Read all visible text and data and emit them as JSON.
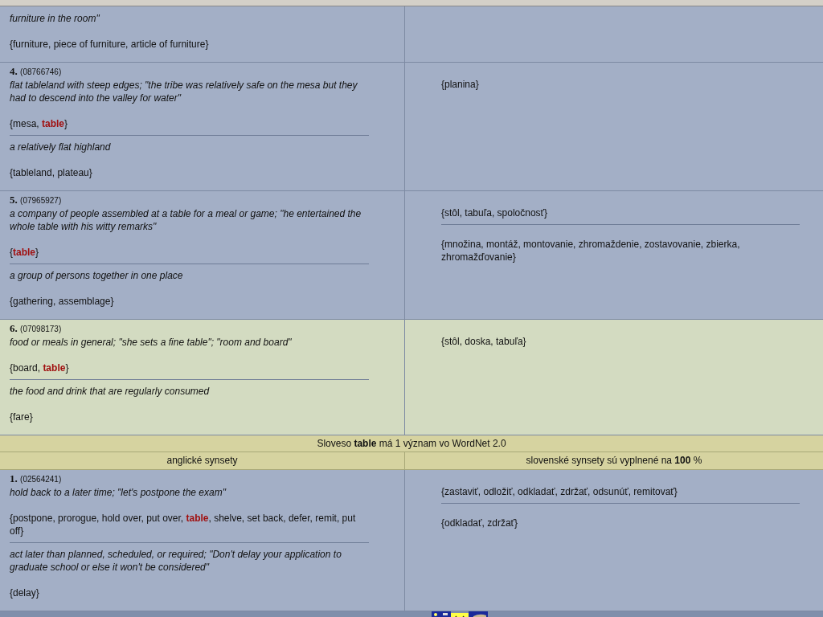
{
  "noun_rows": [
    {
      "highlighted": false,
      "english": [
        {
          "gloss": "furniture in the room\"",
          "synset": "{furniture, piece of furniture, article of furniture}"
        }
      ],
      "slovak": []
    },
    {
      "number": "4.",
      "id": "(08766746)",
      "highlighted": false,
      "english": [
        {
          "gloss": "flat tableland with steep edges; \"the tribe was relatively safe on the mesa but they had to descend into the valley for water\"",
          "synset": "{mesa, **table**}"
        },
        {
          "gloss": "a relatively flat highland",
          "synset": "{tableland, plateau}"
        }
      ],
      "slovak": [
        "{planina}"
      ]
    },
    {
      "number": "5.",
      "id": "(07965927)",
      "highlighted": false,
      "english": [
        {
          "gloss": "a company of people assembled at a table for a meal or game; \"he entertained the whole table with his witty remarks\"",
          "synset": "{**table**}"
        },
        {
          "gloss": "a group of persons together in one place",
          "synset": "{gathering, assemblage}"
        }
      ],
      "slovak": [
        "{stôl, tabuľa, spoločnosť}",
        "{množina, montáž, montovanie, zhromaždenie, zostavovanie, zbierka, zhromažďovanie}"
      ]
    },
    {
      "number": "6.",
      "id": "(07098173)",
      "highlighted": true,
      "english": [
        {
          "gloss": "food or meals in general; \"she sets a fine table\"; \"room and board\"",
          "synset": "{board, **table**}"
        },
        {
          "gloss": "the food and drink that are regularly consumed",
          "synset": "{fare}"
        }
      ],
      "slovak": [
        "{stôl, doska, tabuľa}"
      ]
    }
  ],
  "verb_section": {
    "heading": "Sloveso **table** má 1 význam vo WordNet 2.0",
    "columns": [
      "anglické synsety",
      "slovenské synsety sú vyplnené na **100** %"
    ],
    "rows": [
      {
        "number": "1.",
        "id": "(02564241)",
        "highlighted": false,
        "english": [
          {
            "gloss": "hold back to a later time; \"let's postpone the exam\"",
            "synset": "{postpone, prorogue, hold over, put over, **table**, shelve, set back, defer, remit, put off}"
          },
          {
            "gloss": "act later than planned, scheduled, or required; \"Don't delay your application to graduate school or else it won't be considered\"",
            "synset": "{delay}"
          }
        ],
        "slovak": [
          "{zastaviť, odložiť, odkladať, zdržať, odsunúť, remitovať}",
          "{odkladať, zdržať}"
        ]
      }
    ]
  }
}
